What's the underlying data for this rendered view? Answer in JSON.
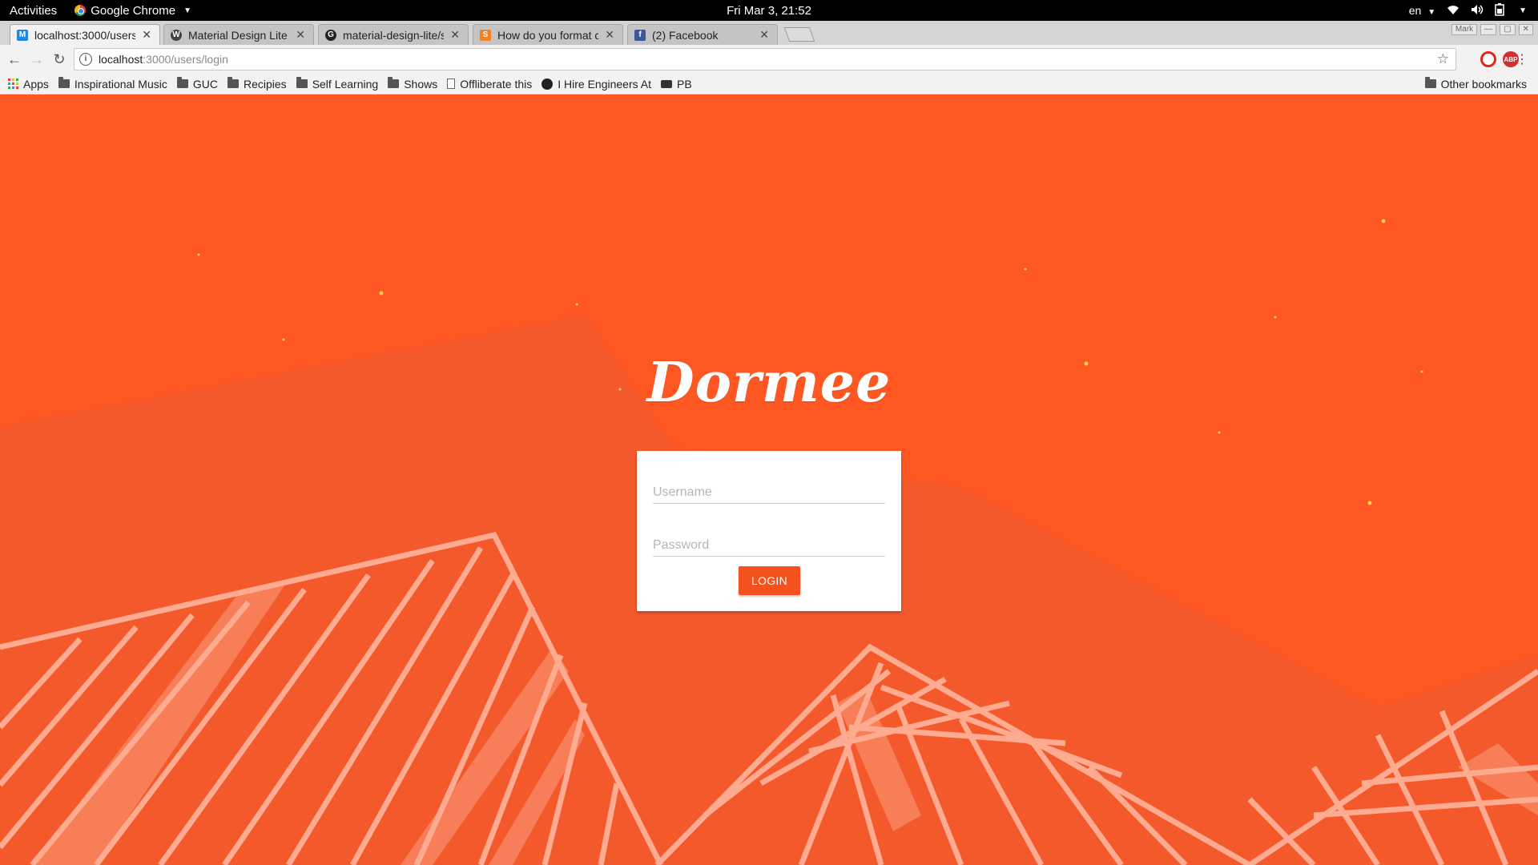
{
  "system_bar": {
    "activities": "Activities",
    "app_name": "Google Chrome",
    "clock": "Fri Mar  3, 21:52",
    "language": "en"
  },
  "tabs": [
    {
      "title": "localhost:3000/users/",
      "favicon": "M",
      "favicon_color": "#1e88e5",
      "active": true
    },
    {
      "title": "Material Design Lite",
      "favicon": "W",
      "favicon_color": "#444444",
      "active": false
    },
    {
      "title": "material-design-lite/s",
      "favicon": "G",
      "favicon_color": "#222222",
      "active": false
    },
    {
      "title": "How do you format c",
      "favicon": "S",
      "favicon_color": "#f48024",
      "active": false
    },
    {
      "title": "(2) Facebook",
      "favicon": "f",
      "favicon_color": "#3b5998",
      "active": false
    }
  ],
  "window_controls": {
    "user": "Mark"
  },
  "address_bar": {
    "host": "localhost",
    "path": ":3000/users/login"
  },
  "bookmarks": [
    {
      "label": "Apps",
      "icon": "apps-icon"
    },
    {
      "label": "Inspirational Music",
      "icon": "folder-icon"
    },
    {
      "label": "GUC",
      "icon": "folder-icon"
    },
    {
      "label": "Recipies",
      "icon": "folder-icon"
    },
    {
      "label": "Self Learning",
      "icon": "folder-icon"
    },
    {
      "label": "Shows",
      "icon": "folder-icon"
    },
    {
      "label": "Offliberate this",
      "icon": "page-icon"
    },
    {
      "label": "I Hire Engineers At",
      "icon": "site-icon"
    },
    {
      "label": "PB",
      "icon": "printer-icon"
    }
  ],
  "other_bookmarks": "Other bookmarks",
  "page": {
    "logo": "Dormee",
    "username_placeholder": "Username",
    "password_placeholder": "Password",
    "login_label": "LOGIN",
    "accent_color": "#ff5722"
  }
}
